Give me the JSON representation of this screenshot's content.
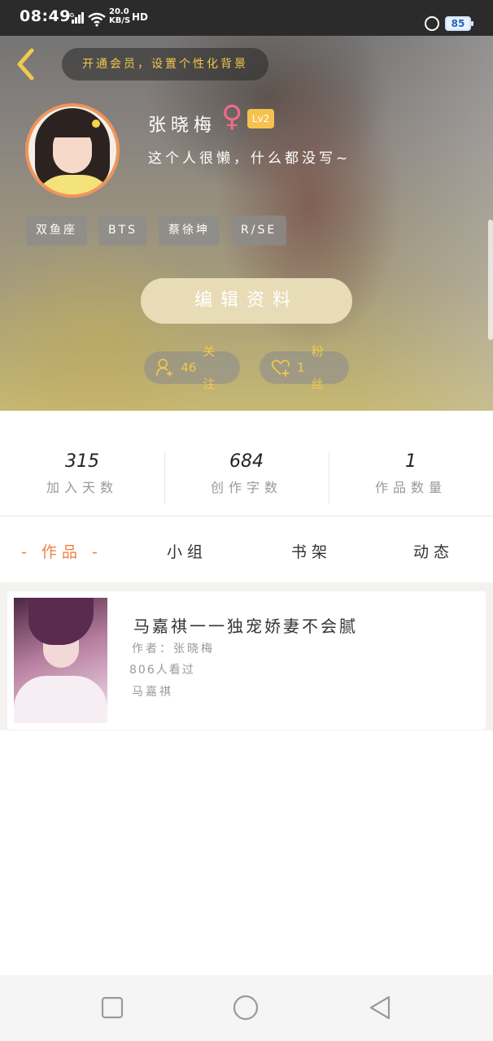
{
  "status_bar": {
    "time": "08:49",
    "network": "4G",
    "speed_value": "20.0",
    "speed_unit": "KB/S",
    "hd_label": "HD",
    "battery": "85"
  },
  "header": {
    "tip": "开通会员，设置个性化背景",
    "name": "张晓梅",
    "gender_symbol": "♀",
    "level": "Lv2",
    "signature": "这个人很懒，什么都没写~",
    "tags": [
      "双鱼座",
      "BTS",
      "蔡徐坤",
      "R/SE"
    ],
    "edit_button": "编辑资料",
    "following": {
      "count": "46",
      "label": "关注"
    },
    "fans": {
      "count": "1",
      "label": "粉丝"
    }
  },
  "stats": [
    {
      "value": "315",
      "label": "加入天数"
    },
    {
      "value": "684",
      "label": "创作字数"
    },
    {
      "value": "1",
      "label": "作品数量"
    }
  ],
  "tabs": [
    {
      "label": "- 作品 -",
      "active": true
    },
    {
      "label": "小组",
      "active": false
    },
    {
      "label": "书架",
      "active": false
    },
    {
      "label": "动态",
      "active": false
    }
  ],
  "works": [
    {
      "title": "马嘉祺一一独宠娇妻不会腻",
      "author": "作者：张晓梅",
      "reads": "806人看过",
      "tag": "马嘉祺"
    }
  ],
  "colors": {
    "accent": "#f07f45",
    "gold": "#f2c94c",
    "edit_button": "#e7dcb6",
    "level_badge": "#f5c24d",
    "female_symbol": "#f06a8a"
  },
  "icons": {
    "back": "chevron-left-icon",
    "follow": "person-add-icon",
    "fans": "heart-add-icon",
    "nav_recents": "square-icon",
    "nav_home": "circle-icon",
    "nav_back": "triangle-back-icon"
  }
}
